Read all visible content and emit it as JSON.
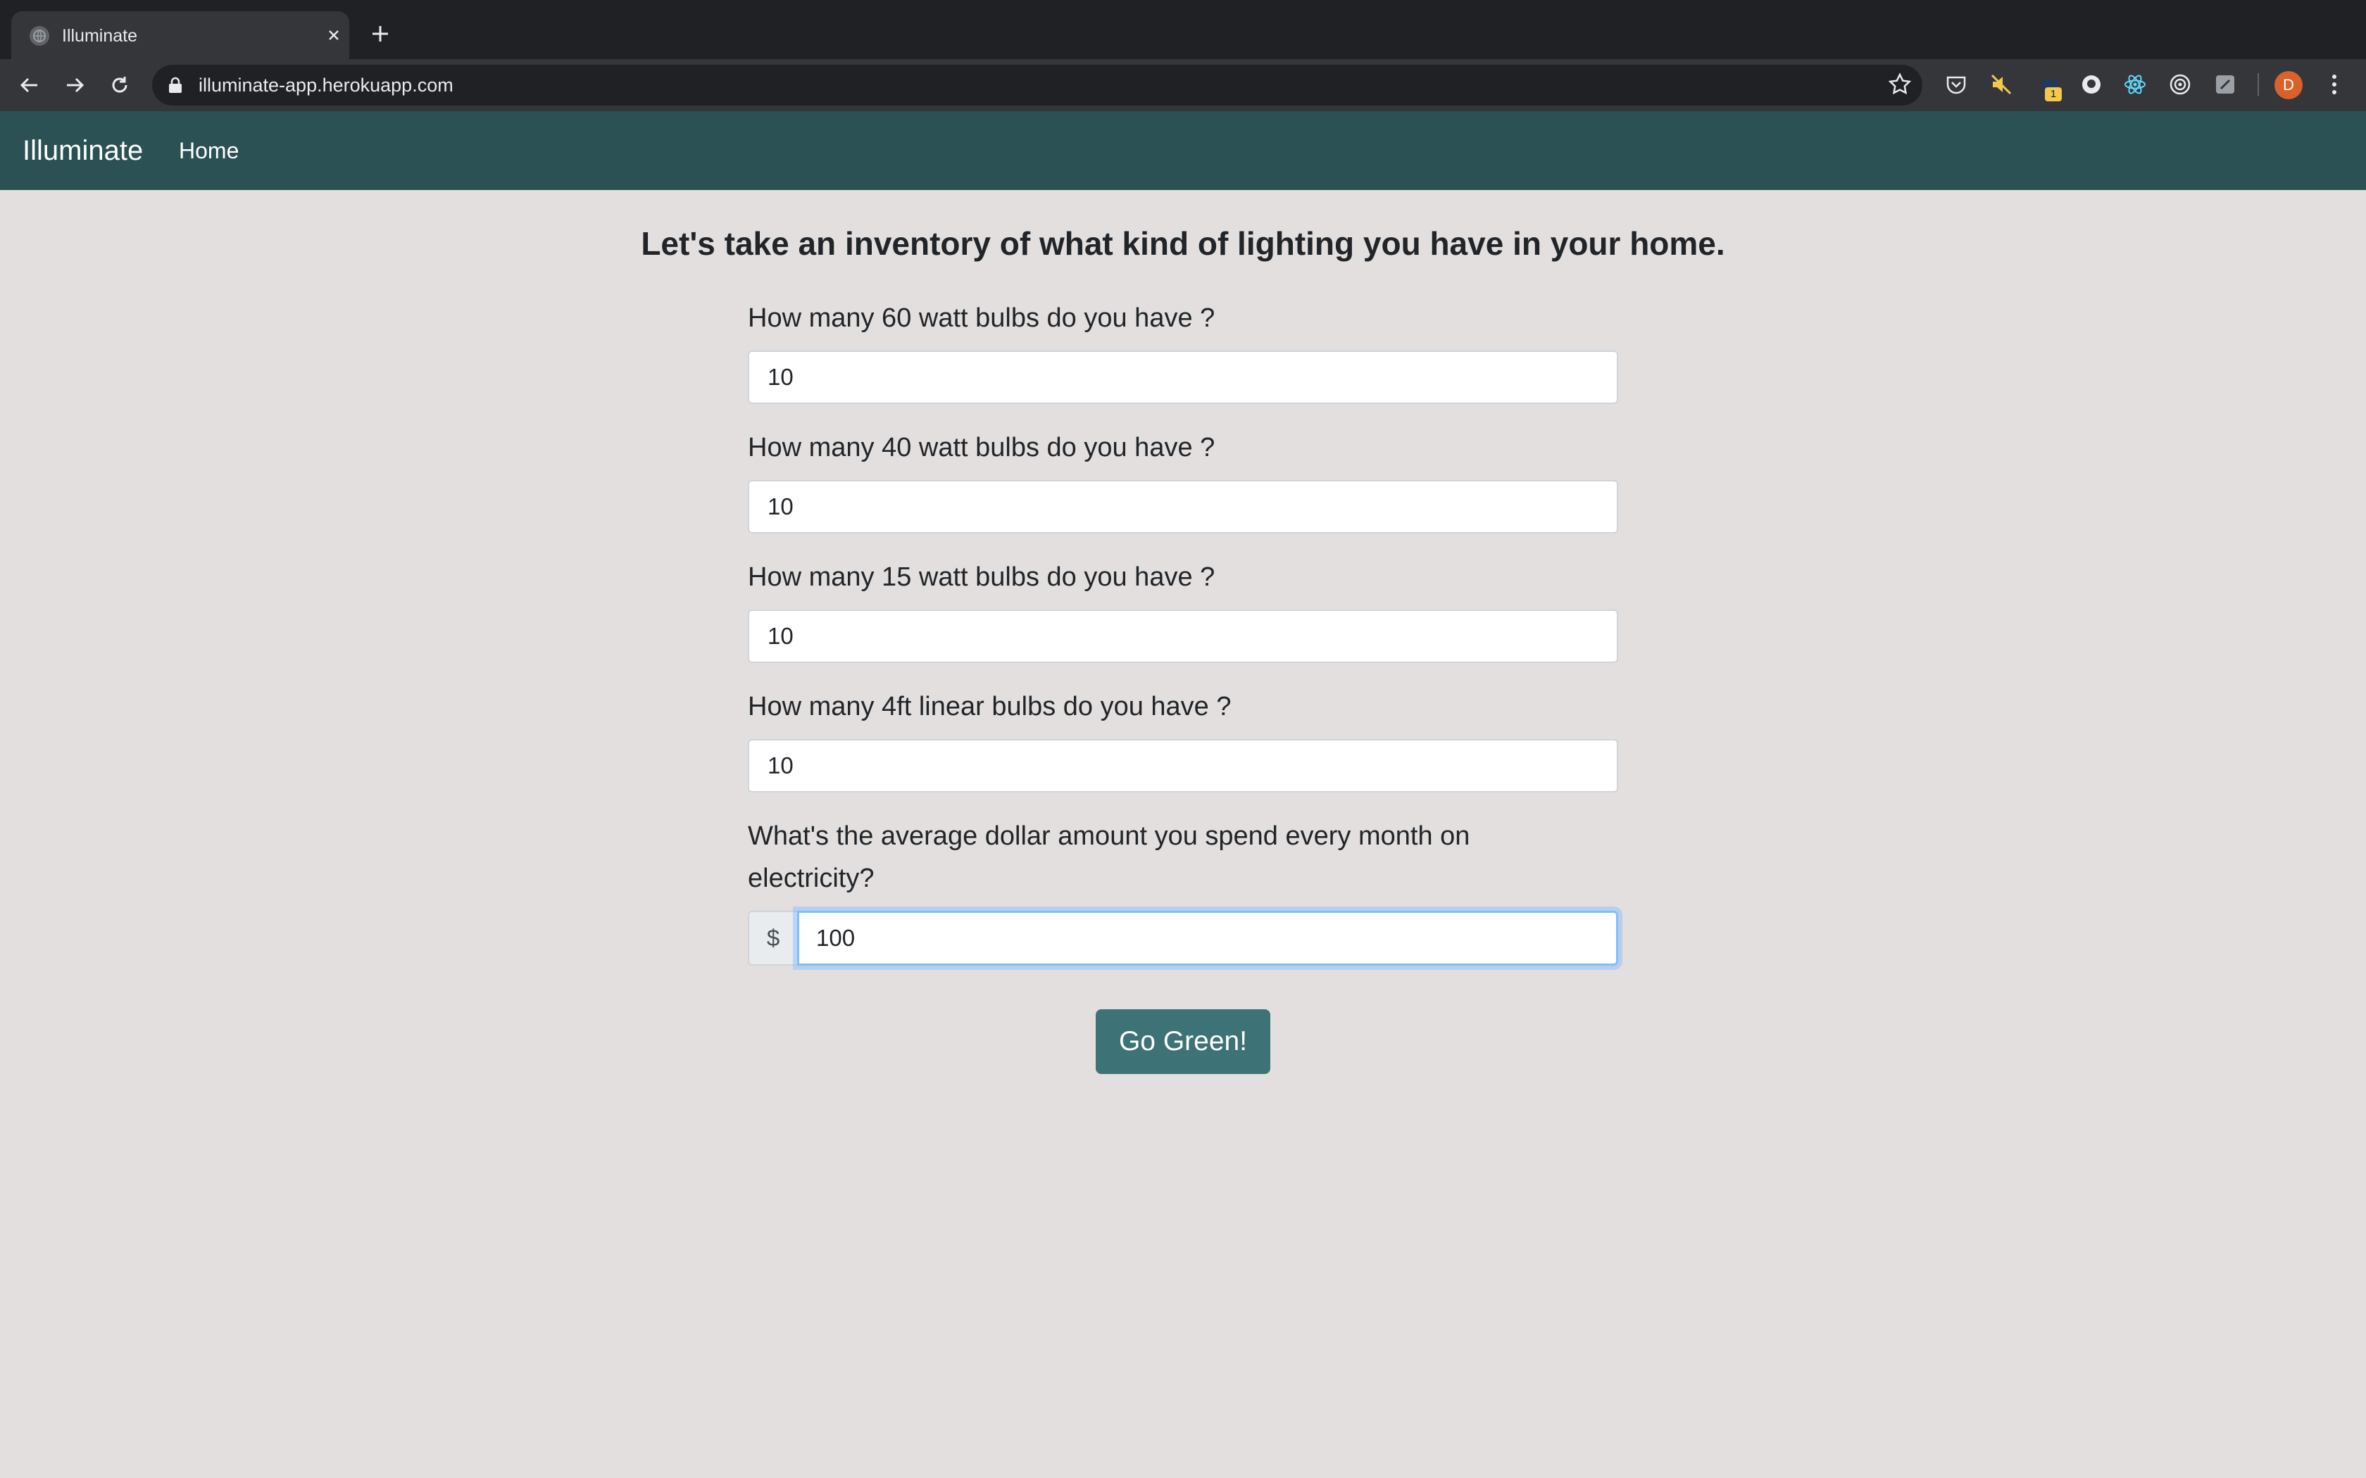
{
  "browser": {
    "tab_title": "Illuminate",
    "url": "illuminate-app.herokuapp.com",
    "extension_badge": "1",
    "avatar_initial": "D"
  },
  "navbar": {
    "brand": "Illuminate",
    "home_link": "Home",
    "background": "#2b5154"
  },
  "form": {
    "heading": "Let's take an inventory of what kind of lighting you have in your home.",
    "fields": [
      {
        "label": "How many 60 watt bulbs do you have ?",
        "value": "10"
      },
      {
        "label": "How many 40 watt bulbs do you have ?",
        "value": "10"
      },
      {
        "label": "How many 15 watt bulbs do you have ?",
        "value": "10"
      },
      {
        "label": "How many 4ft linear bulbs do you have ?",
        "value": "10"
      }
    ],
    "electricity": {
      "label_line1": "What's the average dollar amount you spend every month on",
      "label_line2": "electricity?",
      "prefix": "$",
      "value": "100"
    },
    "submit_label": "Go Green!",
    "button_color": "#3d7376"
  }
}
